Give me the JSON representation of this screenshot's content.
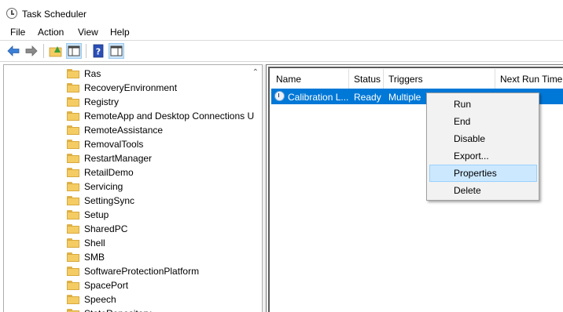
{
  "window": {
    "title": "Task Scheduler"
  },
  "menubar": {
    "items": [
      "File",
      "Action",
      "View",
      "Help"
    ]
  },
  "toolbar": {
    "buttons": [
      "back-arrow-icon",
      "forward-arrow-icon",
      "up-folder-icon",
      "show-hide-tree-icon",
      "help-icon",
      "action-pane-icon"
    ]
  },
  "tree": {
    "items": [
      "Ras",
      "RecoveryEnvironment",
      "Registry",
      "RemoteApp and Desktop Connections U",
      "RemoteAssistance",
      "RemovalTools",
      "RestartManager",
      "RetailDemo",
      "Servicing",
      "SettingSync",
      "Setup",
      "SharedPC",
      "Shell",
      "SMB",
      "SoftwareProtectionPlatform",
      "SpacePort",
      "Speech",
      "StateRepository"
    ]
  },
  "tasklist": {
    "columns": [
      "Name",
      "Status",
      "Triggers",
      "Next Run Time"
    ],
    "rows": [
      {
        "name": "Calibration L...",
        "status": "Ready",
        "triggers": "Multiple"
      }
    ]
  },
  "context_menu": {
    "items": [
      "Run",
      "End",
      "Disable",
      "Export...",
      "Properties",
      "Delete"
    ],
    "highlighted": "Properties"
  }
}
